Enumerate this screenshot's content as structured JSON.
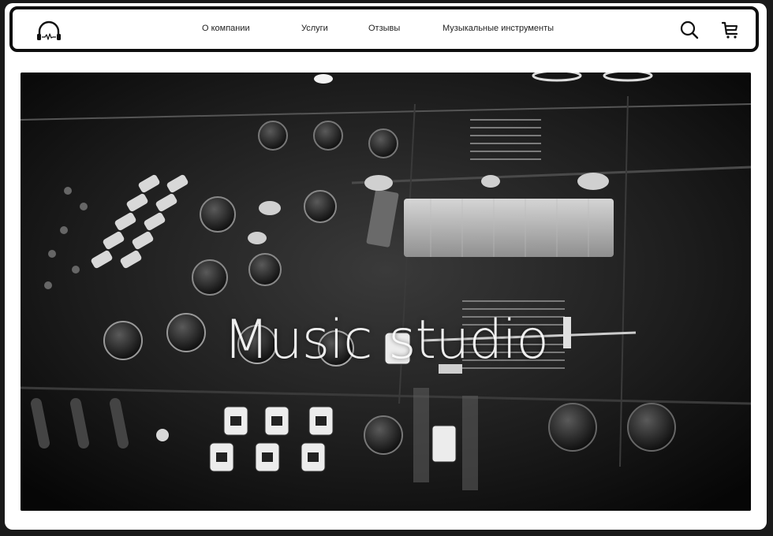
{
  "header": {
    "logo_icon": "headphones-pulse-icon",
    "nav": [
      {
        "label": "О компании"
      },
      {
        "label": "Услуги"
      },
      {
        "label": "Отзывы"
      },
      {
        "label": "Музыкальные инструменты"
      }
    ],
    "search_icon": "search-icon",
    "cart_icon": "cart-icon"
  },
  "hero": {
    "title": "Music studio",
    "background": "dj-mixer-photo"
  },
  "colors": {
    "frame": "#0e0e0e",
    "background": "#ffffff",
    "hero_bg": "#0c0c0c",
    "title": "#ffffff"
  }
}
